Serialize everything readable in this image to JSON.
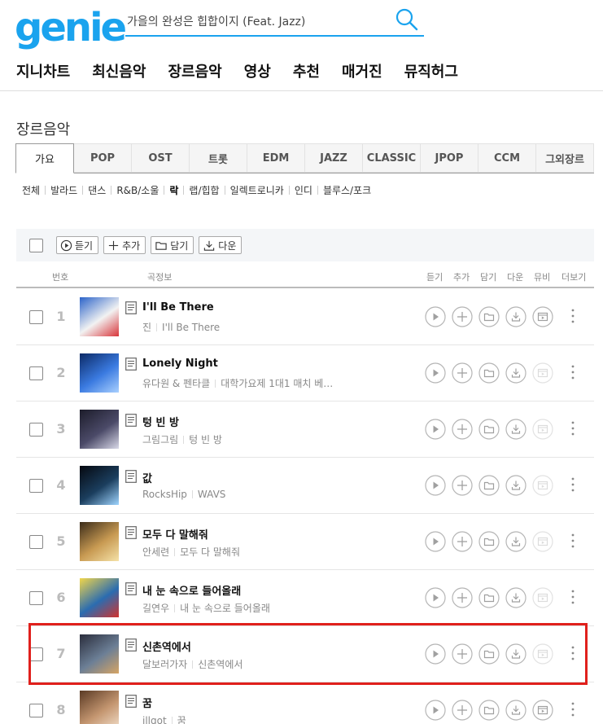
{
  "header": {
    "logo": "genie",
    "search_value": "가을의 완성은 힙합이지 (Feat. Jazz)"
  },
  "gnb": [
    "지니차트",
    "최신음악",
    "장르음악",
    "영상",
    "추천",
    "매거진",
    "뮤직허그"
  ],
  "page_title": "장르음악",
  "genre_tabs": [
    "가요",
    "POP",
    "OST",
    "트롯",
    "EDM",
    "JAZZ",
    "CLASSIC",
    "JPOP",
    "CCM",
    "그외장르"
  ],
  "active_genre_tab": "가요",
  "sub_genres": [
    "전체",
    "발라드",
    "댄스",
    "R&B/소울",
    "락",
    "랩/힙합",
    "일렉트로니카",
    "인디",
    "블루스/포크"
  ],
  "active_sub_genre": "락",
  "toolbar": {
    "listen": "듣기",
    "add": "추가",
    "save": "담기",
    "download": "다운"
  },
  "table_header": {
    "num": "번호",
    "info": "곡정보",
    "listen": "듣기",
    "add": "추가",
    "save": "담기",
    "download": "다운",
    "mv": "뮤비",
    "more": "더보기"
  },
  "songs": [
    {
      "rank": "1",
      "title": "I'll Be There",
      "artist": "진",
      "album": "I'll Be There",
      "mv": true,
      "cover_colors": [
        "#2b63c9",
        "#f2f2f2",
        "#d8353a"
      ]
    },
    {
      "rank": "2",
      "title": "Lonely Night",
      "artist": "유다원 & 펜타클",
      "album": "대학가요제 1대1 매치 베…",
      "mv": false,
      "cover_colors": [
        "#0c2a66",
        "#3a7ae0",
        "#a9d0ff"
      ]
    },
    {
      "rank": "3",
      "title": "텅 빈 방",
      "artist": "그림그림",
      "album": "텅 빈 방",
      "mv": false,
      "cover_colors": [
        "#1c1c2a",
        "#4b4a68",
        "#d9d9e8"
      ]
    },
    {
      "rank": "4",
      "title": "값",
      "artist": "RocksHip",
      "album": "WAVS",
      "mv": false,
      "cover_colors": [
        "#05080f",
        "#1b3e5e",
        "#9fd5ff"
      ]
    },
    {
      "rank": "5",
      "title": "모두 다 말해줘",
      "artist": "안세련",
      "album": "모두 다 말해줘",
      "mv": false,
      "cover_colors": [
        "#3b2c1a",
        "#c89a52",
        "#f5e2a8"
      ]
    },
    {
      "rank": "6",
      "title": "내 눈 속으로 들어올래",
      "artist": "길연우",
      "album": "내 눈 속으로 들어올래",
      "mv": false,
      "cover_colors": [
        "#f1d64a",
        "#2b6cb0",
        "#d2322d"
      ]
    },
    {
      "rank": "7",
      "title": "신촌역에서",
      "artist": "달보러가자",
      "album": "신촌역에서",
      "mv": false,
      "cover_colors": [
        "#2a2d3c",
        "#6c7f96",
        "#d6a464"
      ]
    },
    {
      "rank": "8",
      "title": "꿈",
      "artist": "illgot",
      "album": "꿈",
      "mv": true,
      "cover_colors": [
        "#5a3a24",
        "#c49670",
        "#f3e0cc"
      ]
    }
  ],
  "colors": {
    "brand": "#1aa3ee",
    "highlight": "#e0201c"
  },
  "highlighted_rank": "7"
}
